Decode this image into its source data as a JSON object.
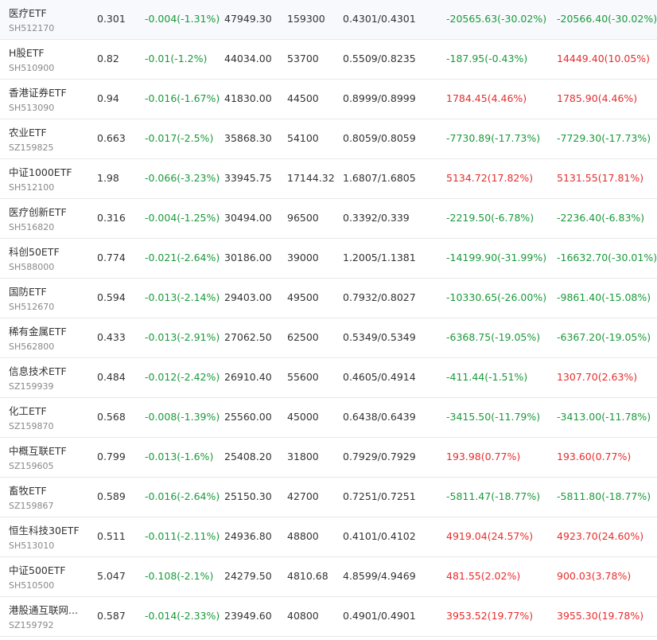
{
  "colors": {
    "up": "#e52e2e",
    "down": "#1a9a3a",
    "text": "#333333",
    "code": "#888888"
  },
  "rows": [
    {
      "name": "医疗ETF",
      "code": "SH512170",
      "price": "0.301",
      "change": "-0.004(-1.31%)",
      "change_dir": "down",
      "amount": "47949.30",
      "volume": "159300",
      "nav": "0.4301/0.4301",
      "flow1": "-20565.63(-30.02%)",
      "flow1_dir": "down",
      "flow2": "-20566.40(-30.02%)",
      "flow2_dir": "down"
    },
    {
      "name": "H股ETF",
      "code": "SH510900",
      "price": "0.82",
      "change": "-0.01(-1.2%)",
      "change_dir": "down",
      "amount": "44034.00",
      "volume": "53700",
      "nav": "0.5509/0.8235",
      "flow1": "-187.95(-0.43%)",
      "flow1_dir": "down",
      "flow2": "14449.40(10.05%)",
      "flow2_dir": "up"
    },
    {
      "name": "香港证券ETF",
      "code": "SH513090",
      "price": "0.94",
      "change": "-0.016(-1.67%)",
      "change_dir": "down",
      "amount": "41830.00",
      "volume": "44500",
      "nav": "0.8999/0.8999",
      "flow1": "1784.45(4.46%)",
      "flow1_dir": "up",
      "flow2": "1785.90(4.46%)",
      "flow2_dir": "up"
    },
    {
      "name": "农业ETF",
      "code": "SZ159825",
      "price": "0.663",
      "change": "-0.017(-2.5%)",
      "change_dir": "down",
      "amount": "35868.30",
      "volume": "54100",
      "nav": "0.8059/0.8059",
      "flow1": "-7730.89(-17.73%)",
      "flow1_dir": "down",
      "flow2": "-7729.30(-17.73%)",
      "flow2_dir": "down"
    },
    {
      "name": "中证1000ETF",
      "code": "SH512100",
      "price": "1.98",
      "change": "-0.066(-3.23%)",
      "change_dir": "down",
      "amount": "33945.75",
      "volume": "17144.32",
      "nav": "1.6807/1.6805",
      "flow1": "5134.72(17.82%)",
      "flow1_dir": "up",
      "flow2": "5131.55(17.81%)",
      "flow2_dir": "up"
    },
    {
      "name": "医疗创新ETF",
      "code": "SH516820",
      "price": "0.316",
      "change": "-0.004(-1.25%)",
      "change_dir": "down",
      "amount": "30494.00",
      "volume": "96500",
      "nav": "0.3392/0.339",
      "flow1": "-2219.50(-6.78%)",
      "flow1_dir": "down",
      "flow2": "-2236.40(-6.83%)",
      "flow2_dir": "down"
    },
    {
      "name": "科创50ETF",
      "code": "SH588000",
      "price": "0.774",
      "change": "-0.021(-2.64%)",
      "change_dir": "down",
      "amount": "30186.00",
      "volume": "39000",
      "nav": "1.2005/1.1381",
      "flow1": "-14199.90(-31.99%)",
      "flow1_dir": "down",
      "flow2": "-16632.70(-30.01%)",
      "flow2_dir": "down"
    },
    {
      "name": "国防ETF",
      "code": "SH512670",
      "price": "0.594",
      "change": "-0.013(-2.14%)",
      "change_dir": "down",
      "amount": "29403.00",
      "volume": "49500",
      "nav": "0.7932/0.8027",
      "flow1": "-10330.65(-26.00%)",
      "flow1_dir": "down",
      "flow2": "-9861.40(-15.08%)",
      "flow2_dir": "down"
    },
    {
      "name": "稀有金属ETF",
      "code": "SH562800",
      "price": "0.433",
      "change": "-0.013(-2.91%)",
      "change_dir": "down",
      "amount": "27062.50",
      "volume": "62500",
      "nav": "0.5349/0.5349",
      "flow1": "-6368.75(-19.05%)",
      "flow1_dir": "down",
      "flow2": "-6367.20(-19.05%)",
      "flow2_dir": "down"
    },
    {
      "name": "信息技术ETF",
      "code": "SZ159939",
      "price": "0.484",
      "change": "-0.012(-2.42%)",
      "change_dir": "down",
      "amount": "26910.40",
      "volume": "55600",
      "nav": "0.4605/0.4914",
      "flow1": "-411.44(-1.51%)",
      "flow1_dir": "down",
      "flow2": "1307.70(2.63%)",
      "flow2_dir": "up"
    },
    {
      "name": "化工ETF",
      "code": "SZ159870",
      "price": "0.568",
      "change": "-0.008(-1.39%)",
      "change_dir": "down",
      "amount": "25560.00",
      "volume": "45000",
      "nav": "0.6438/0.6439",
      "flow1": "-3415.50(-11.79%)",
      "flow1_dir": "down",
      "flow2": "-3413.00(-11.78%)",
      "flow2_dir": "down"
    },
    {
      "name": "中概互联ETF",
      "code": "SZ159605",
      "price": "0.799",
      "change": "-0.013(-1.6%)",
      "change_dir": "down",
      "amount": "25408.20",
      "volume": "31800",
      "nav": "0.7929/0.7929",
      "flow1": "193.98(0.77%)",
      "flow1_dir": "up",
      "flow2": "193.60(0.77%)",
      "flow2_dir": "up"
    },
    {
      "name": "畜牧ETF",
      "code": "SZ159867",
      "price": "0.589",
      "change": "-0.016(-2.64%)",
      "change_dir": "down",
      "amount": "25150.30",
      "volume": "42700",
      "nav": "0.7251/0.7251",
      "flow1": "-5811.47(-18.77%)",
      "flow1_dir": "down",
      "flow2": "-5811.80(-18.77%)",
      "flow2_dir": "down"
    },
    {
      "name": "恒生科技30ETF",
      "code": "SH513010",
      "price": "0.511",
      "change": "-0.011(-2.11%)",
      "change_dir": "down",
      "amount": "24936.80",
      "volume": "48800",
      "nav": "0.4101/0.4102",
      "flow1": "4919.04(24.57%)",
      "flow1_dir": "up",
      "flow2": "4923.70(24.60%)",
      "flow2_dir": "up"
    },
    {
      "name": "中证500ETF",
      "code": "SH510500",
      "price": "5.047",
      "change": "-0.108(-2.1%)",
      "change_dir": "down",
      "amount": "24279.50",
      "volume": "4810.68",
      "nav": "4.8599/4.9469",
      "flow1": "481.55(2.02%)",
      "flow1_dir": "up",
      "flow2": "900.03(3.78%)",
      "flow2_dir": "up"
    },
    {
      "name": "港股通互联网...",
      "code": "SZ159792",
      "price": "0.587",
      "change": "-0.014(-2.33%)",
      "change_dir": "down",
      "amount": "23949.60",
      "volume": "40800",
      "nav": "0.4901/0.4901",
      "flow1": "3953.52(19.77%)",
      "flow1_dir": "up",
      "flow2": "3955.30(19.78%)",
      "flow2_dir": "up"
    }
  ]
}
